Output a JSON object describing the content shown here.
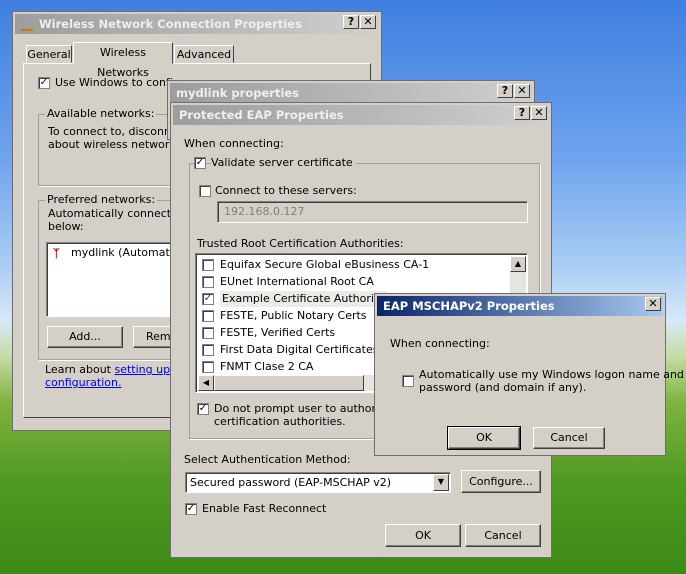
{
  "wireless": {
    "title": "Wireless Network Connection Properties",
    "tabs": [
      "General",
      "Wireless Networks",
      "Advanced"
    ],
    "use_windows_label": "Use Windows to configu",
    "available_label": "Available networks:",
    "available_text_1": "To connect to, disconnec",
    "available_text_2": "about wireless networks i",
    "preferred_label": "Preferred networks:",
    "preferred_text_1": "Automatically connect to",
    "preferred_text_2": "below:",
    "network_item": "mydlink (Automatic)",
    "add_button": "Add...",
    "remove_button": "Rem",
    "learn_text": "Learn about",
    "learn_link_1": "setting up wir",
    "learn_link_2": "configuration."
  },
  "mydlink": {
    "title": "mydlink properties"
  },
  "peap": {
    "title": "Protected EAP Properties",
    "when_connecting": "When connecting:",
    "validate_label": "Validate server certificate",
    "connect_servers_label": "Connect to these servers:",
    "server_value": "192.168.0.127",
    "trusted_label": "Trusted Root Certification Authorities:",
    "cert_list": [
      {
        "name": "Equifax Secure Global eBusiness CA-1",
        "checked": false
      },
      {
        "name": "EUnet International Root CA",
        "checked": false
      },
      {
        "name": "Example Certificate Authority",
        "checked": true
      },
      {
        "name": "FESTE, Public Notary Certs",
        "checked": false
      },
      {
        "name": "FESTE, Verified Certs",
        "checked": false
      },
      {
        "name": "First Data Digital Certificates Inc",
        "checked": false
      },
      {
        "name": "FNMT Clase 2 CA",
        "checked": false
      }
    ],
    "no_prompt_line1": "Do not prompt user to authorize n",
    "no_prompt_line2": "certification authorities.",
    "auth_method_label": "Select Authentication Method:",
    "auth_method_value": "Secured password (EAP-MSCHAP v2)",
    "configure_button": "Configure...",
    "fast_reconnect_label": "Enable Fast Reconnect",
    "ok_button": "OK",
    "cancel_button": "Cancel"
  },
  "mschap": {
    "title": "EAP MSCHAPv2 Properties",
    "when_connecting": "When connecting:",
    "auto_logon_line1": "Automatically use my Windows logon name and",
    "auto_logon_line2": "password (and domain if any).",
    "ok_button": "OK",
    "cancel_button": "Cancel"
  },
  "title_buttons": {
    "help": "?",
    "close": "✕"
  },
  "icons": {
    "check": "✓",
    "up_arrow": "▲",
    "down_arrow": "▼",
    "left_arrow": "◀",
    "right_arrow": "▶"
  }
}
